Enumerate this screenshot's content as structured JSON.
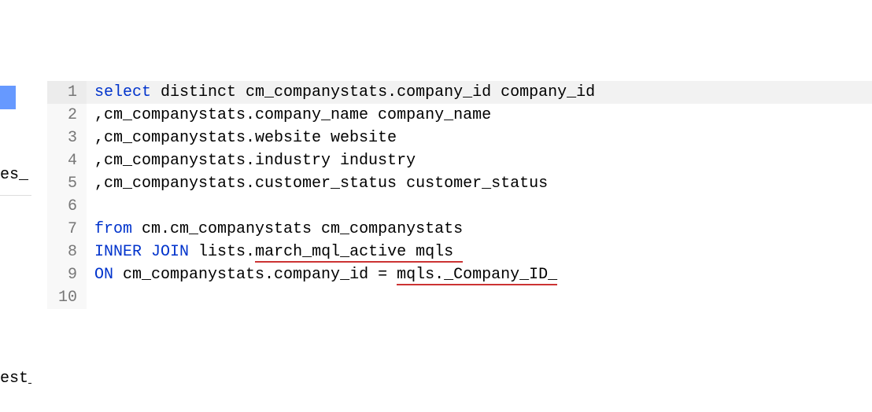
{
  "leftPanel": {
    "label1": "es_",
    "label2": "est_"
  },
  "code": {
    "lines": [
      {
        "num": "1",
        "hl": true,
        "tokens": [
          {
            "t": "select",
            "cls": "kw"
          },
          {
            "t": " distinct cm_companystats.company_id company_id"
          }
        ]
      },
      {
        "num": "2",
        "tokens": [
          {
            "t": ",cm_companystats.company_name company_name"
          }
        ]
      },
      {
        "num": "3",
        "tokens": [
          {
            "t": ",cm_companystats.website website"
          }
        ]
      },
      {
        "num": "4",
        "tokens": [
          {
            "t": ",cm_companystats.industry industry"
          }
        ]
      },
      {
        "num": "5",
        "tokens": [
          {
            "t": ",cm_companystats.customer_status customer_status"
          }
        ]
      },
      {
        "num": "6",
        "tokens": [
          {
            "t": ""
          }
        ]
      },
      {
        "num": "7",
        "tokens": [
          {
            "t": "from",
            "cls": "kw"
          },
          {
            "t": " cm.cm_companystats cm_companystats"
          }
        ]
      },
      {
        "num": "8",
        "tokens": [
          {
            "t": "INNER",
            "cls": "kw"
          },
          {
            "t": " "
          },
          {
            "t": "JOIN",
            "cls": "kw"
          },
          {
            "t": " lists."
          },
          {
            "t": "march_mql_active mqls ",
            "cls": "err"
          }
        ]
      },
      {
        "num": "9",
        "tokens": [
          {
            "t": "ON",
            "cls": "kw"
          },
          {
            "t": " cm_companystats.company_id = "
          },
          {
            "t": "mqls._Company_ID_",
            "cls": "err"
          }
        ]
      },
      {
        "num": "10",
        "tokens": [
          {
            "t": ""
          }
        ]
      }
    ]
  }
}
